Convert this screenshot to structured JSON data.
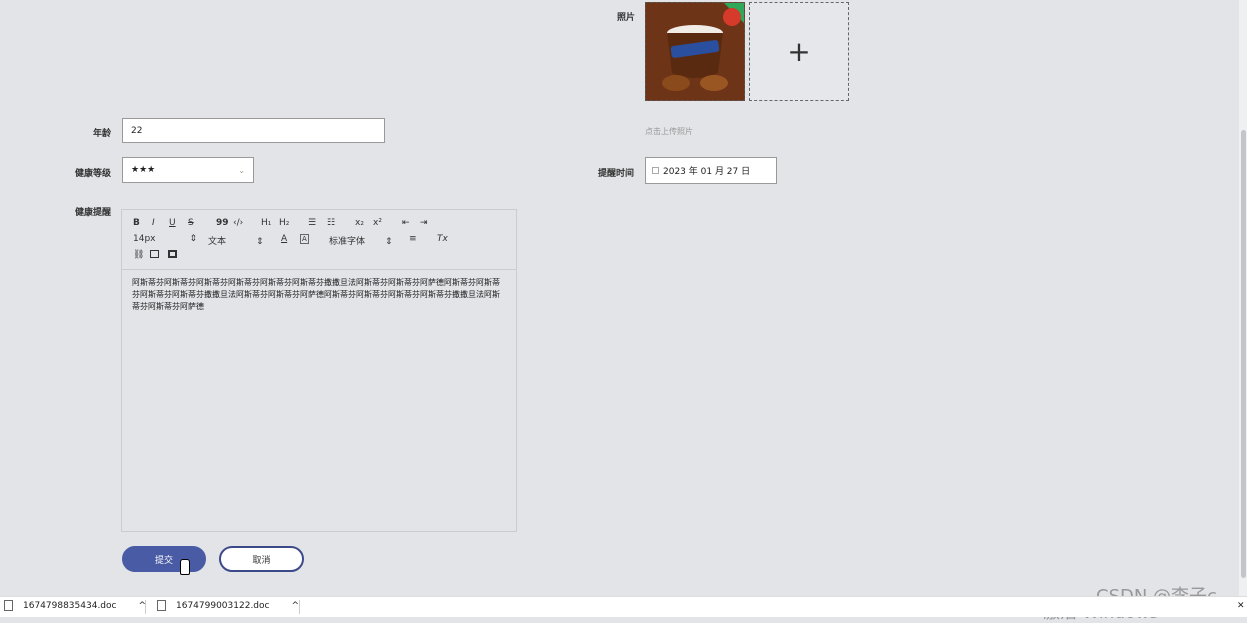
{
  "form": {
    "photo_label": "照片",
    "photo_hint": "点击上传照片",
    "photo_add_symbol": "+",
    "age_label": "年龄",
    "age_value": "22",
    "health_level_label": "健康等级",
    "health_level_value": "★★★",
    "reminder_time_label": "提醒时间",
    "reminder_time_value": "2023 年 01 月 27 日",
    "health_reminder_label": "健康提醒"
  },
  "editor": {
    "toolbar": {
      "bold": "B",
      "italic": "I",
      "underline": "U",
      "strike": "S",
      "quote": "99",
      "code": "‹/›",
      "h1": "H₁",
      "h2": "H₂",
      "ordered_list": "☰",
      "bullet_list": "☷",
      "subscript": "x₂",
      "superscript": "x²",
      "indent_decrease": "⇤",
      "indent_increase": "⇥",
      "font_size": "14px",
      "text_style": "文本",
      "font_family": "标准字体",
      "color": "A",
      "background": "A",
      "align": "≡",
      "clear_format": "Tx"
    },
    "content": "阿斯蒂芬阿斯蒂芬阿斯蒂芬阿斯蒂芬阿斯蒂芬阿斯蒂芬撒撒旦法阿斯蒂芬阿斯蒂芬阿萨德阿斯蒂芬阿斯蒂芬阿斯蒂芬阿斯蒂芬撒撒旦法阿斯蒂芬阿斯蒂芬阿萨德阿斯蒂芬阿斯蒂芬阿斯蒂芬阿斯蒂芬撒撒旦法阿斯蒂芬阿斯蒂芬阿萨德"
  },
  "buttons": {
    "submit": "提交",
    "cancel": "取消"
  },
  "taskbar": {
    "download1": "1674798835434.doc",
    "download2": "1674799003122.doc",
    "chevron": "^",
    "close": "✕"
  },
  "watermark": {
    "activate": "激活 Windows",
    "csdn": "CSDN @李子c"
  },
  "colors": {
    "primary": "#4a5ba5",
    "background": "#e3e4e8"
  }
}
